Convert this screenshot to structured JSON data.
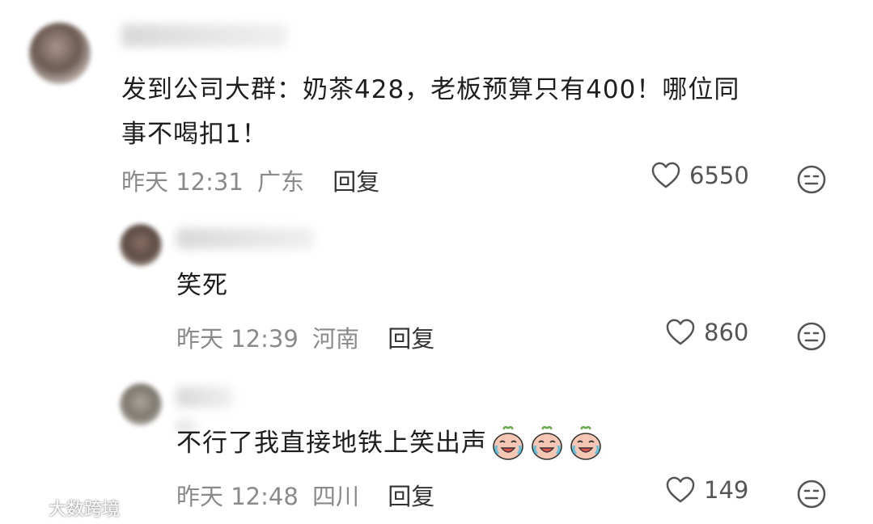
{
  "comments": [
    {
      "text_line1": "发到公司大群：奶茶428，老板预算只有400！哪位同",
      "text_line2": "事不喝扣1！",
      "time": "昨天 12:31",
      "location": "广东",
      "reply_label": "回复",
      "likes": "6550"
    },
    {
      "text": "笑死",
      "time": "昨天 12:39",
      "location": "河南",
      "reply_label": "回复",
      "likes": "860"
    },
    {
      "text": "不行了我直接地铁上笑出声",
      "time": "昨天 12:48",
      "location": "四川",
      "reply_label": "回复",
      "likes": "149"
    }
  ],
  "watermark": "大数跨境",
  "icons": {
    "like": "heart-outline-icon",
    "emote": "neutral-face-icon",
    "emoji": "laugh-cry-face-emoji"
  }
}
